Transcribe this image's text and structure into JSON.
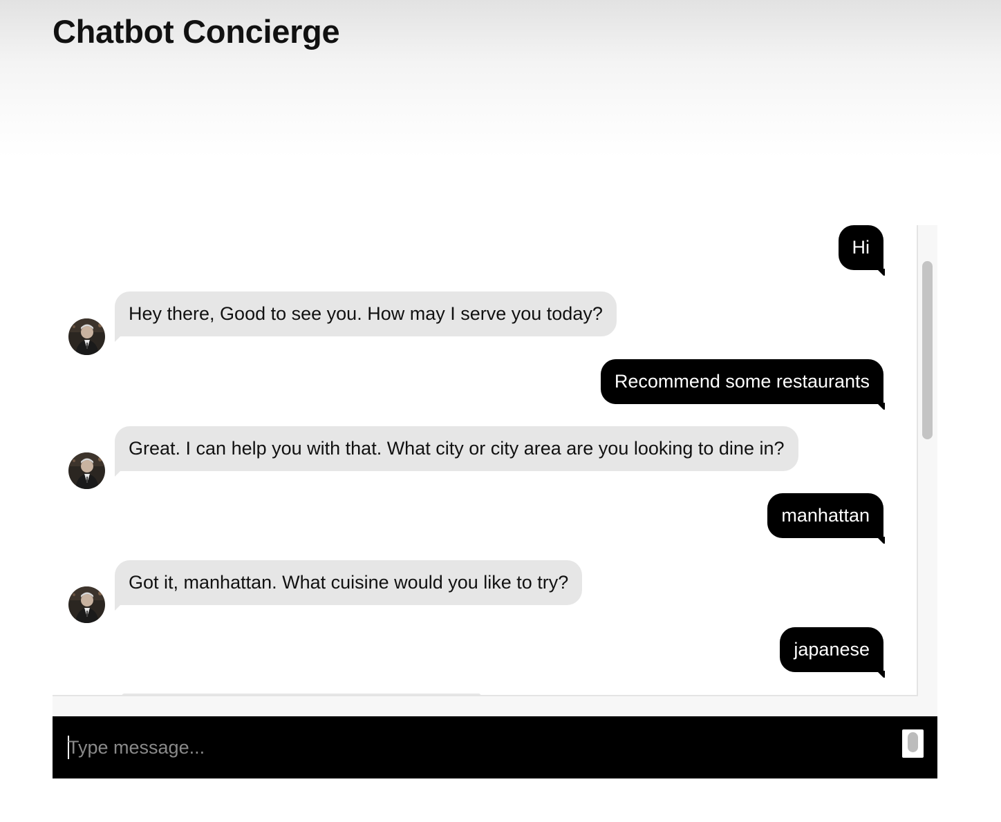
{
  "app": {
    "title": "Chatbot Concierge"
  },
  "messages": [
    {
      "from": "user",
      "text": "Hi"
    },
    {
      "from": "bot",
      "text": "Hey there, Good to see you. How may I serve you today?"
    },
    {
      "from": "user",
      "text": "Recommend some restaurants"
    },
    {
      "from": "bot",
      "text": "Great. I can help you with that. What city or city area are you looking to dine in?"
    },
    {
      "from": "user",
      "text": "manhattan"
    },
    {
      "from": "bot",
      "text": "Got it, manhattan. What cuisine would you like to try?"
    },
    {
      "from": "user",
      "text": "japanese"
    }
  ],
  "composer": {
    "placeholder": "Type message...",
    "value": ""
  },
  "colors": {
    "user_bubble": "#000000",
    "bot_bubble": "#e6e6e6",
    "composer_bg": "#000000"
  },
  "icons": {
    "bot_avatar": "bot-avatar-photo",
    "send": "send-icon"
  }
}
